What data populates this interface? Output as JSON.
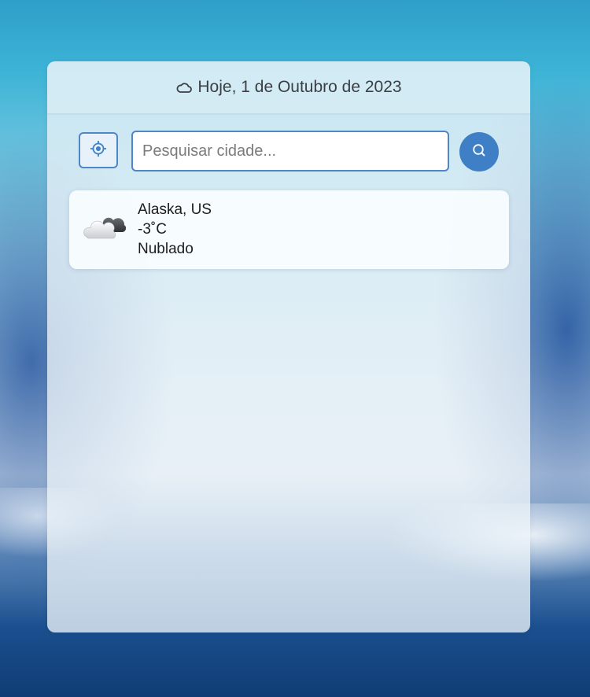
{
  "header": {
    "date_label": "Hoje, 1 de Outubro de 2023",
    "icon": "cloud-icon"
  },
  "search": {
    "placeholder": "Pesquisar cidade...",
    "value": "",
    "location_button_icon": "crosshair-icon",
    "search_button_icon": "search-icon"
  },
  "results": [
    {
      "location": "Alaska, US",
      "temperature": "-3˚C",
      "condition": "Nublado",
      "icon": "cloudy-icon"
    }
  ],
  "colors": {
    "accent": "#3f7fc6",
    "border": "#4f86c6"
  }
}
